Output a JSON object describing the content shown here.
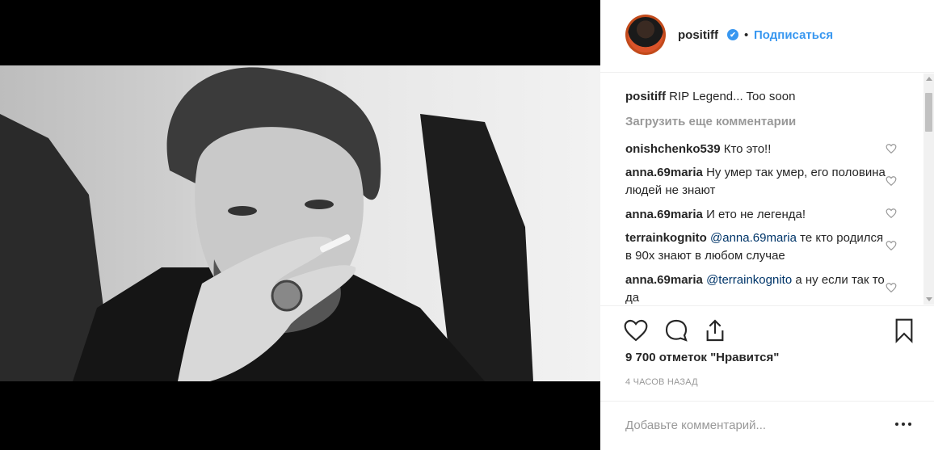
{
  "header": {
    "username": "positiff",
    "verified_mark": "✔",
    "separator": "•",
    "follow_label": "Подписаться"
  },
  "caption": {
    "username": "positiff",
    "text": "RIP Legend... Too soon"
  },
  "load_more_label": "Загрузить еще комментарии",
  "comments": [
    {
      "username": "onishchenko539",
      "mention": "",
      "text": "Кто это!!"
    },
    {
      "username": "anna.69maria",
      "mention": "",
      "text": "Ну умер так умер, его половина людей не знают"
    },
    {
      "username": "anna.69maria",
      "mention": "",
      "text": "И ето не легенда!"
    },
    {
      "username": "terrainkognito",
      "mention": "@anna.69maria",
      "text": "те кто родился в 90х знают в любом случае"
    },
    {
      "username": "anna.69maria",
      "mention": "@terrainkognito",
      "text": "а ну если так то да"
    }
  ],
  "likes_label": "9 700 отметок \"Нравится\"",
  "timestamp": "4 ЧАСОВ НАЗАД",
  "add_comment_placeholder": "Добавьте комментарий...",
  "icons": {
    "like": "heart-icon",
    "comment": "comment-icon",
    "share": "share-icon",
    "save": "bookmark-icon",
    "comment_like": "heart-icon",
    "more": "more-options-icon"
  },
  "colors": {
    "link": "#3897f0",
    "mention": "#003569",
    "muted": "#999999",
    "text": "#262626"
  }
}
